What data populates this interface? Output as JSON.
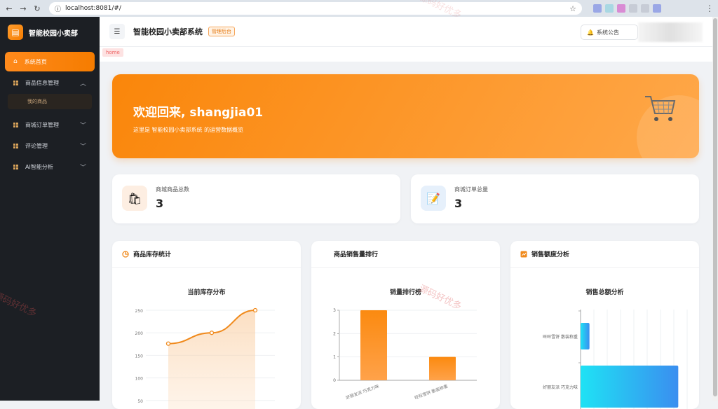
{
  "browser": {
    "url": "localhost:8081/#/"
  },
  "sidebar": {
    "brand": "智能校园小卖部",
    "items": [
      {
        "label": "系统首页",
        "active": true
      },
      {
        "label": "商品信息管理",
        "expanded": true
      },
      {
        "label": "我的商品"
      },
      {
        "label": "商城订单管理"
      },
      {
        "label": "评论管理"
      },
      {
        "label": "AI智能分析"
      }
    ]
  },
  "header": {
    "title": "智能校园小卖部系统",
    "badge": "管理后台",
    "notice": "系统公告"
  },
  "tag": "home",
  "banner": {
    "welcome": "欢迎回来, shangjia01",
    "subtitle": "这里是 智能校园小卖部系统 的运营数据概览"
  },
  "stats": [
    {
      "label": "商城商品总数",
      "value": "3"
    },
    {
      "label": "商城订单总量",
      "value": "3"
    }
  ],
  "charts": [
    {
      "header": "商品库存统计",
      "title": "当前库存分布"
    },
    {
      "header": "商品销售量排行",
      "title": "销量排行榜"
    },
    {
      "header": "销售额度分析",
      "title": "销售总额分析"
    }
  ],
  "watermark": "源码好优多",
  "chart_data": [
    {
      "type": "area",
      "title": "当前库存分布",
      "y_ticks": [
        50,
        100,
        150,
        200,
        250
      ],
      "ylim": [
        0,
        250
      ],
      "values": [
        176,
        200,
        250
      ]
    },
    {
      "type": "bar",
      "title": "销量排行榜",
      "categories": [
        "好丽友派 巧克力味",
        "旺旺雪饼 散装称重"
      ],
      "values": [
        3,
        1
      ],
      "ylim": [
        0,
        3
      ],
      "y_ticks": [
        0,
        1,
        2,
        3
      ]
    },
    {
      "type": "bar",
      "orientation": "horizontal",
      "title": "销售总额分析",
      "categories": [
        "旺旺雪饼 散装称重",
        "好丽友派 巧克力味"
      ],
      "values": [
        2,
        22
      ],
      "xlim": [
        0,
        24
      ]
    }
  ]
}
